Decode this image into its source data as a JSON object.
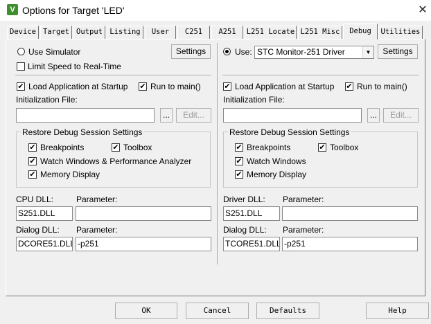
{
  "window": {
    "title": "Options for Target 'LED'",
    "icon_letter": "V",
    "close_symbol": "✕"
  },
  "tabs": [
    {
      "label": "Device"
    },
    {
      "label": "Target"
    },
    {
      "label": "Output"
    },
    {
      "label": "Listing"
    },
    {
      "label": "User"
    },
    {
      "label": "C251"
    },
    {
      "label": "A251"
    },
    {
      "label": "L251 Locate"
    },
    {
      "label": "L251 Misc"
    },
    {
      "label": "Debug"
    },
    {
      "label": "Utilities"
    }
  ],
  "active_tab": "Debug",
  "left": {
    "use_simulator": "Use Simulator",
    "limit_speed": "Limit Speed to Real-Time",
    "settings_btn": "Settings",
    "load_app": "Load Application at Startup",
    "run_to_main": "Run to main()",
    "init_file_label": "Initialization File:",
    "browse_btn": "...",
    "edit_btn": "Edit...",
    "restore_group": "Restore Debug Session Settings",
    "breakpoints": "Breakpoints",
    "toolbox": "Toolbox",
    "watch": "Watch Windows & Performance Analyzer",
    "memory": "Memory Display",
    "dll_label": "CPU DLL:",
    "param_label": "Parameter:",
    "dll_value": "S251.DLL",
    "dll_param": "",
    "dialog_label": "Dialog DLL:",
    "dialog_param_label": "Parameter:",
    "dialog_value": "DCORE51.DLL",
    "dialog_param": "-p251"
  },
  "right": {
    "use_label": "Use:",
    "driver": "STC Monitor-251 Driver",
    "settings_btn": "Settings",
    "load_app": "Load Application at Startup",
    "run_to_main": "Run to main()",
    "init_file_label": "Initialization File:",
    "browse_btn": "...",
    "edit_btn": "Edit...",
    "restore_group": "Restore Debug Session Settings",
    "breakpoints": "Breakpoints",
    "toolbox": "Toolbox",
    "watch": "Watch Windows",
    "memory": "Memory Display",
    "dll_label": "Driver DLL:",
    "param_label": "Parameter:",
    "dll_value": "S251.DLL",
    "dll_param": "",
    "dialog_label": "Dialog DLL:",
    "dialog_param_label": "Parameter:",
    "dialog_value": "TCORE51.DLL",
    "dialog_param": "-p251"
  },
  "buttons": {
    "ok": "OK",
    "cancel": "Cancel",
    "defaults": "Defaults",
    "help": "Help"
  },
  "check_symbol": "✔"
}
